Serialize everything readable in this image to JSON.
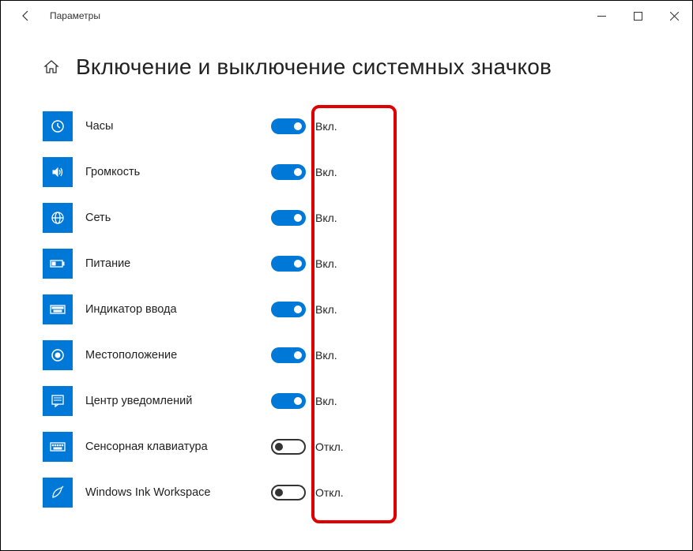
{
  "window": {
    "title": "Параметры"
  },
  "page": {
    "title": "Включение и выключение системных значков"
  },
  "toggle_states": {
    "on": "Вкл.",
    "off": "Откл."
  },
  "items": [
    {
      "icon": "clock",
      "label": "Часы",
      "state": "on"
    },
    {
      "icon": "volume",
      "label": "Громкость",
      "state": "on"
    },
    {
      "icon": "globe",
      "label": "Сеть",
      "state": "on"
    },
    {
      "icon": "battery",
      "label": "Питание",
      "state": "on"
    },
    {
      "icon": "keyboard",
      "label": "Индикатор ввода",
      "state": "on"
    },
    {
      "icon": "location",
      "label": "Местоположение",
      "state": "on"
    },
    {
      "icon": "notifications",
      "label": "Центр уведомлений",
      "state": "on"
    },
    {
      "icon": "touch-keyboard",
      "label": "Сенсорная клавиатура",
      "state": "off"
    },
    {
      "icon": "ink",
      "label": "Windows Ink Workspace",
      "state": "off"
    }
  ]
}
